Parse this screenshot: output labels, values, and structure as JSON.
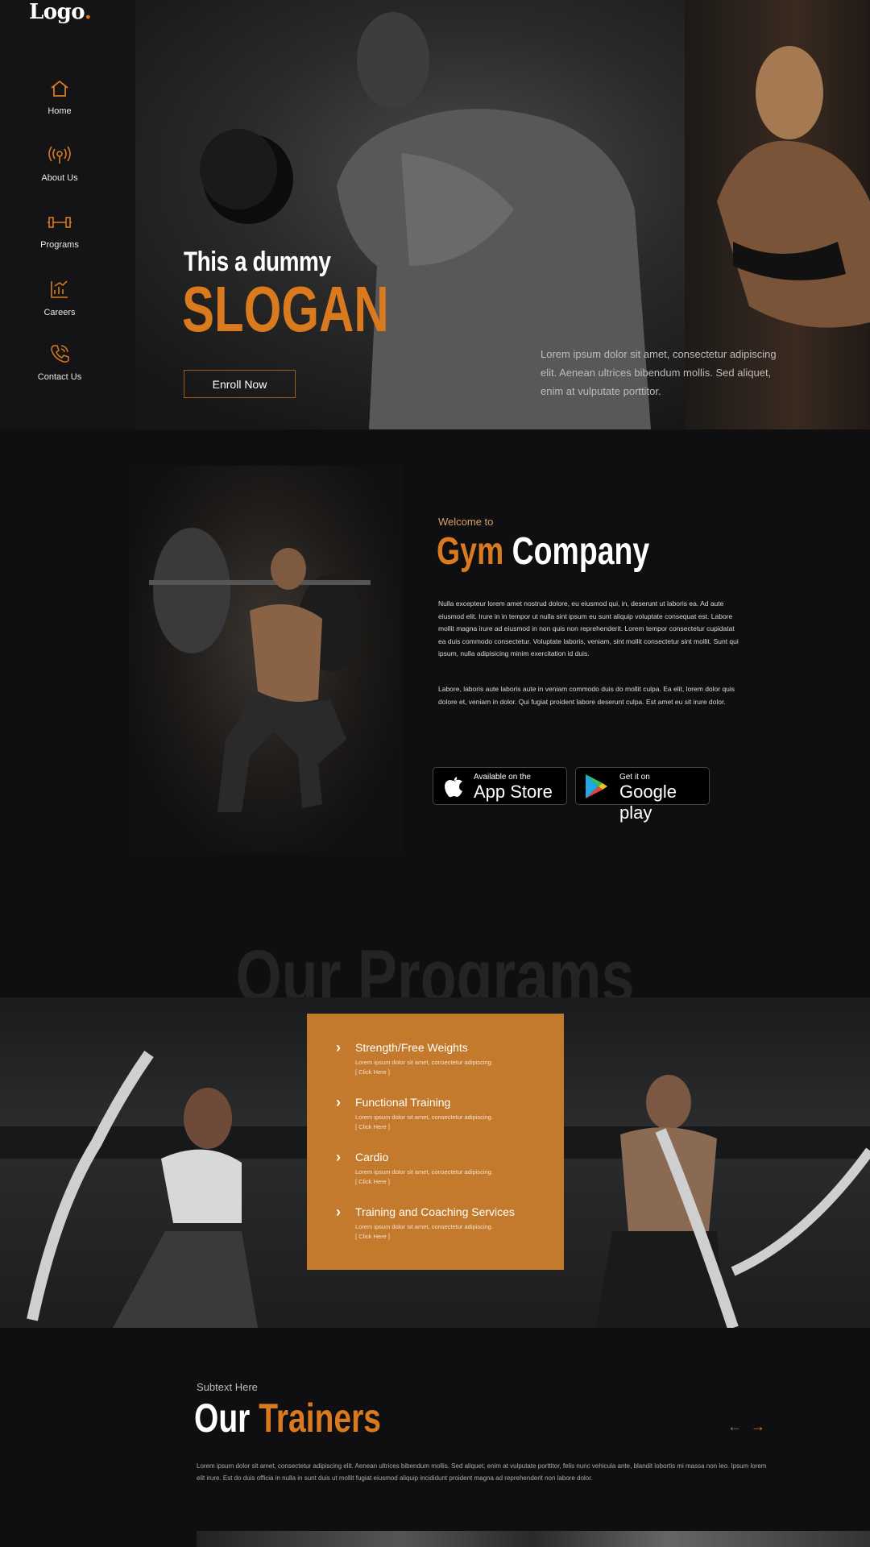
{
  "logo": {
    "text": "Logo",
    "dot": "."
  },
  "nav": {
    "items": [
      {
        "label": "Home",
        "icon": "home-icon"
      },
      {
        "label": "About Us",
        "icon": "broadcast-icon"
      },
      {
        "label": "Programs",
        "icon": "dumbbell-icon"
      },
      {
        "label": "Careers",
        "icon": "chart-icon"
      },
      {
        "label": "Contact Us",
        "icon": "phone-icon"
      }
    ]
  },
  "hero": {
    "slogan_small": "This a dummy",
    "slogan_big": "SLOGAN",
    "enroll_label": "Enroll Now",
    "text": "Lorem ipsum dolor sit amet, consectetur adipiscing elit. Aenean ultrices bibendum mollis. Sed aliquet, enim at vulputate porttitor."
  },
  "about": {
    "welcome": "Welcome to",
    "title_accent": "Gym",
    "title_rest": "Company",
    "paragraph1": "Nulla excepteur lorem amet nostrud dolore, eu eiusmod qui, in, deserunt ut laboris ea. Ad aute eiusmod elit. Irure in in tempor ut nulla sint ipsum eu sunt aliquip voluptate consequat est. Labore mollit magna irure ad eiusmod in non quis non reprehenderit. Lorem tempor consectetur cupidatat ea duis commodo consectetur. Voluptate laboris, veniam, sint mollit consectetur sint mollit. Sunt qui ipsum, nulla adipisicing minim exercitation id duis.",
    "paragraph2": "Labore, laboris aute laboris aute in veniam commodo duis do mollit culpa. Ea elit, lorem dolor quis dolore et, veniam in dolor. Qui fugiat proident labore deserunt culpa. Est amet eu sit irure dolor.",
    "appstore_small": "Available on the",
    "appstore_large": "App Store",
    "googleplay_small": "Get it on",
    "googleplay_large": "Google play"
  },
  "programs": {
    "bg_title": "Our Programs",
    "items": [
      {
        "title": "Strength/Free Weights",
        "desc": "Lorem ipsum dolor sit amet, consectetur adipiscing.",
        "link": "[ Click Here ]"
      },
      {
        "title": "Functional Training",
        "desc": "Lorem ipsum dolor sit amet, consectetur adipiscing.",
        "link": "[ Click Here ]"
      },
      {
        "title": "Cardio",
        "desc": "Lorem ipsum dolor sit amet, consectetur adipiscing.",
        "link": "[ Click Here ]"
      },
      {
        "title": "Training and Coaching Services",
        "desc": "Lorem ipsum dolor sit amet, consectetur adipiscing.",
        "link": "[ Click Here ]"
      }
    ]
  },
  "trainers": {
    "subtext": "Subtext Here",
    "title_main": "Our",
    "title_accent": "Trainers",
    "prev": "←",
    "next": "→",
    "text": "Lorem ipsum dolor sit amet, consectetur adipiscing elit. Aenean ultrices bibendum mollis. Sed aliquet, enim at vulputate porttitor, felis nunc vehicula ante, blandit lobortis mi massa non leo. Ipsum lorem elit irure. Est do duis officia in nulla in sunt duis ut mollit fugiat eiusmod aliquip incididunt proident magna ad reprehenderit non labore dolor."
  },
  "colors": {
    "accent": "#d97a1f",
    "card": "#c47a2c",
    "bg": "#0f0f11"
  }
}
